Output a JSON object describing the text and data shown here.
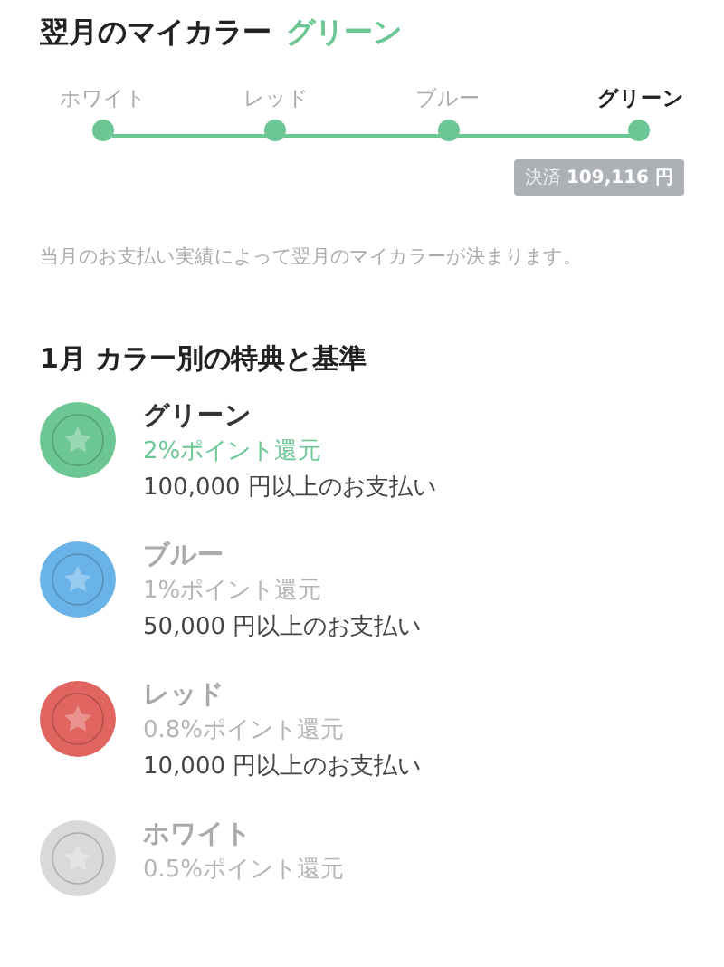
{
  "header": {
    "title": "翌月のマイカラー",
    "current_color": "グリーン"
  },
  "steps": [
    {
      "label": "ホワイト",
      "selected": false
    },
    {
      "label": "レッド",
      "selected": false
    },
    {
      "label": "ブルー",
      "selected": false
    },
    {
      "label": "グリーン",
      "selected": true
    }
  ],
  "payment": {
    "label": "決済",
    "amount": "109,116 円"
  },
  "note": "当月のお支払い実績によって翌月のマイカラーが決まります。",
  "section_title": "1月 カラー別の特典と基準",
  "tiers": [
    {
      "name": "グリーン",
      "reward": "2%ポイント還元",
      "requirement": "100,000 円以上のお支払い",
      "color": "#6cc795",
      "selected": true
    },
    {
      "name": "ブルー",
      "reward": "1%ポイント還元",
      "requirement": "50,000 円以上のお支払い",
      "color": "#6ab3e8",
      "selected": false
    },
    {
      "name": "レッド",
      "reward": "0.8%ポイント還元",
      "requirement": "10,000 円以上のお支払い",
      "color": "#e0645f",
      "selected": false
    },
    {
      "name": "ホワイト",
      "reward": "0.5%ポイント還元",
      "color": "#d9d9d9",
      "selected": false
    }
  ]
}
